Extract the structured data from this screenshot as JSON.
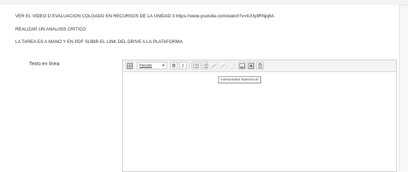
{
  "instructions": {
    "line1": "VER EL VIDEO D EVALUACION COLGADO EN RECURSOS DE LA UNIDAD 3 https://www.youtube.com/watch?v=lUUyIlRNjq6A",
    "line2": "REALIZAR UN ANALISIS CRITICO",
    "line3": "LA TAREA ES A MANO Y EN PDF SUBIR EL LINK DEL DRIVE A LA PLATAFORMA"
  },
  "field": {
    "label": "Texto en línea"
  },
  "editor": {
    "format_value": "Párrafo",
    "bold": "B",
    "italic": "I",
    "tooltip": "Insertar/editar hipervínculo",
    "content": ""
  }
}
